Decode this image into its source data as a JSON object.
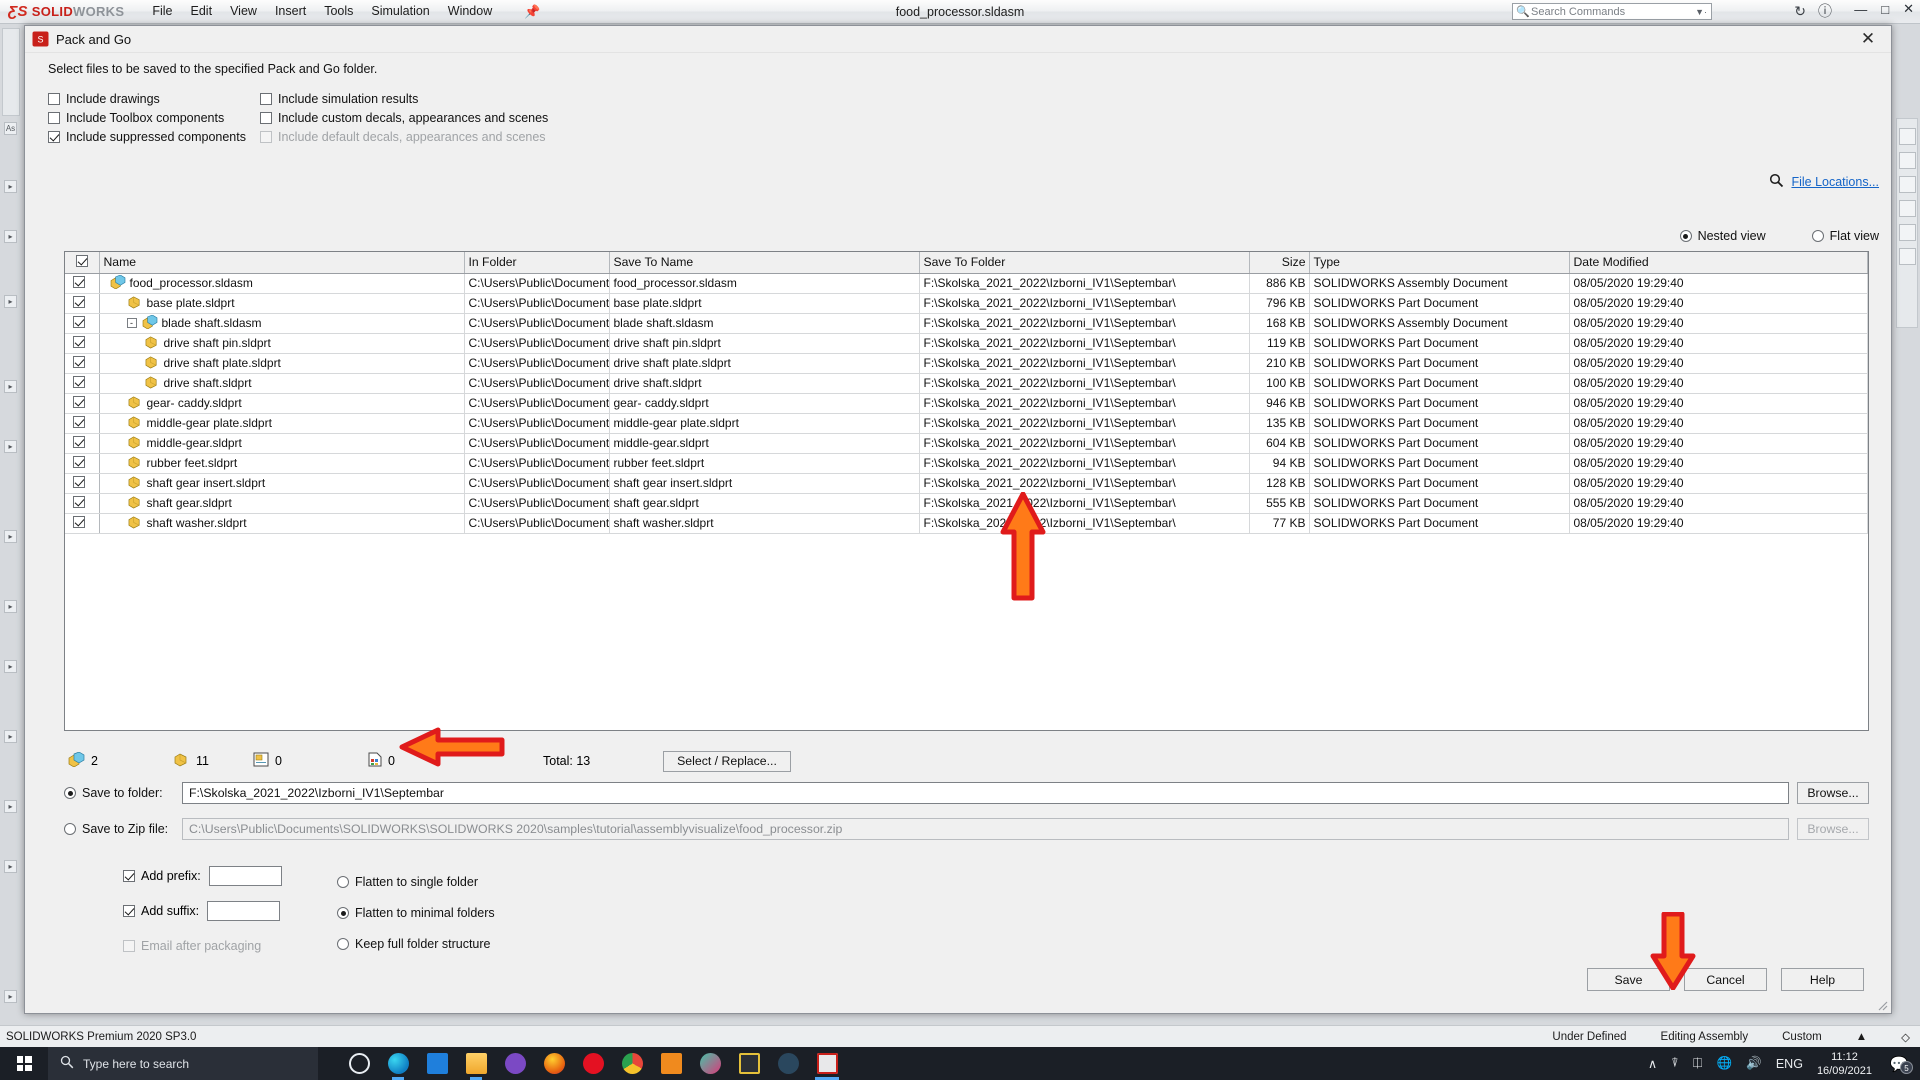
{
  "app": {
    "brand_ds": "3DS",
    "brand_solid": "SOLID",
    "brand_works": "WORKS",
    "menu": [
      "File",
      "Edit",
      "View",
      "Insert",
      "Tools",
      "Simulation",
      "Window"
    ],
    "pin_icon": "pin-icon",
    "document_title": "food_processor.sldasm",
    "search_placeholder": "Search Commands",
    "search_icon": "search-icon",
    "status_left": "SOLIDWORKS Premium 2020 SP3.0",
    "status_right": [
      "Under Defined",
      "Editing Assembly",
      "Custom"
    ],
    "accent_red": "#c8201a"
  },
  "taskbar": {
    "start_icon": "windows-start-icon",
    "search_placeholder": "Type here to search",
    "search_icon": "search-icon",
    "icons": [
      "cortana-icon",
      "microsoft-edge-icon",
      "mail-icon",
      "file-explorer-icon",
      "viber-icon",
      "firefox-icon",
      "opera-icon",
      "google-chrome-icon",
      "movies-tv-icon",
      "dropbox-icon",
      "sublime-text-icon",
      "steam-icon",
      "solidworks-icon"
    ],
    "tray_icons": [
      "chevron-up-icon",
      "screen-record-icon",
      "bluetooth-icon",
      "network-icon",
      "volume-icon"
    ],
    "language": "ENG",
    "time": "11:12",
    "date": "16/09/2021",
    "notification_icon": "notification-icon",
    "notification_count": "5"
  },
  "dialog": {
    "title": "Pack and Go",
    "title_icon": "solidworks-cube-icon",
    "close_icon": "close-icon",
    "instruction": "Select files to be saved to the specified Pack and Go folder.",
    "include_options_col1": [
      {
        "label": "Include drawings",
        "checked": false,
        "disabled": false
      },
      {
        "label": "Include Toolbox components",
        "checked": false,
        "disabled": false
      },
      {
        "label": "Include suppressed components",
        "checked": true,
        "disabled": false
      }
    ],
    "include_options_col2": [
      {
        "label": "Include simulation results",
        "checked": false,
        "disabled": false
      },
      {
        "label": "Include custom decals, appearances and scenes",
        "checked": false,
        "disabled": false
      },
      {
        "label": "Include default decals, appearances and scenes",
        "checked": false,
        "disabled": true
      }
    ],
    "file_locations_link": "File Locations...",
    "file_locations_icon": "search-icon",
    "view_modes": [
      {
        "label": "Nested view",
        "selected": true
      },
      {
        "label": "Flat view",
        "selected": false
      }
    ],
    "table": {
      "select_all_checked": true,
      "columns": [
        "Name",
        "In Folder",
        "Save To Name",
        "Save To Folder",
        "Size",
        "Type",
        "Date Modified"
      ],
      "rows": [
        {
          "checked": true,
          "indent": 0,
          "expander": "",
          "icon": "assembly-icon",
          "name": "food_processor.sldasm",
          "in_folder": "C:\\Users\\Public\\Documents",
          "save_to_name": "food_processor.sldasm",
          "save_to_folder": "F:\\Skolska_2021_2022\\Izborni_IV1\\Septembar\\",
          "size": "886 KB",
          "type": "SOLIDWORKS Assembly Document",
          "date_modified": "08/05/2020 19:29:40"
        },
        {
          "checked": true,
          "indent": 1,
          "expander": "",
          "icon": "part-icon",
          "name": "base plate.sldprt",
          "in_folder": "C:\\Users\\Public\\Documents",
          "save_to_name": "base plate.sldprt",
          "save_to_folder": "F:\\Skolska_2021_2022\\Izborni_IV1\\Septembar\\",
          "size": "796 KB",
          "type": "SOLIDWORKS Part Document",
          "date_modified": "08/05/2020 19:29:40"
        },
        {
          "checked": true,
          "indent": 1,
          "expander": "-",
          "icon": "assembly-icon",
          "name": "blade shaft.sldasm",
          "in_folder": "C:\\Users\\Public\\Documents",
          "save_to_name": "blade shaft.sldasm",
          "save_to_folder": "F:\\Skolska_2021_2022\\Izborni_IV1\\Septembar\\",
          "size": "168 KB",
          "type": "SOLIDWORKS Assembly Document",
          "date_modified": "08/05/2020 19:29:40"
        },
        {
          "checked": true,
          "indent": 2,
          "expander": "",
          "icon": "part-icon",
          "name": "drive shaft pin.sldprt",
          "in_folder": "C:\\Users\\Public\\Documents",
          "save_to_name": "drive shaft pin.sldprt",
          "save_to_folder": "F:\\Skolska_2021_2022\\Izborni_IV1\\Septembar\\",
          "size": "119 KB",
          "type": "SOLIDWORKS Part Document",
          "date_modified": "08/05/2020 19:29:40"
        },
        {
          "checked": true,
          "indent": 2,
          "expander": "",
          "icon": "part-icon",
          "name": "drive shaft plate.sldprt",
          "in_folder": "C:\\Users\\Public\\Documents",
          "save_to_name": "drive shaft plate.sldprt",
          "save_to_folder": "F:\\Skolska_2021_2022\\Izborni_IV1\\Septembar\\",
          "size": "210 KB",
          "type": "SOLIDWORKS Part Document",
          "date_modified": "08/05/2020 19:29:40"
        },
        {
          "checked": true,
          "indent": 2,
          "expander": "",
          "icon": "part-icon",
          "name": "drive shaft.sldprt",
          "in_folder": "C:\\Users\\Public\\Documents",
          "save_to_name": "drive shaft.sldprt",
          "save_to_folder": "F:\\Skolska_2021_2022\\Izborni_IV1\\Septembar\\",
          "size": "100 KB",
          "type": "SOLIDWORKS Part Document",
          "date_modified": "08/05/2020 19:29:40"
        },
        {
          "checked": true,
          "indent": 1,
          "expander": "",
          "icon": "part-icon",
          "name": "gear- caddy.sldprt",
          "in_folder": "C:\\Users\\Public\\Documents",
          "save_to_name": "gear- caddy.sldprt",
          "save_to_folder": "F:\\Skolska_2021_2022\\Izborni_IV1\\Septembar\\",
          "size": "946 KB",
          "type": "SOLIDWORKS Part Document",
          "date_modified": "08/05/2020 19:29:40"
        },
        {
          "checked": true,
          "indent": 1,
          "expander": "",
          "icon": "part-icon",
          "name": "middle-gear plate.sldprt",
          "in_folder": "C:\\Users\\Public\\Documents",
          "save_to_name": "middle-gear plate.sldprt",
          "save_to_folder": "F:\\Skolska_2021_2022\\Izborni_IV1\\Septembar\\",
          "size": "135 KB",
          "type": "SOLIDWORKS Part Document",
          "date_modified": "08/05/2020 19:29:40"
        },
        {
          "checked": true,
          "indent": 1,
          "expander": "",
          "icon": "part-icon",
          "name": "middle-gear.sldprt",
          "in_folder": "C:\\Users\\Public\\Documents",
          "save_to_name": "middle-gear.sldprt",
          "save_to_folder": "F:\\Skolska_2021_2022\\Izborni_IV1\\Septembar\\",
          "size": "604 KB",
          "type": "SOLIDWORKS Part Document",
          "date_modified": "08/05/2020 19:29:40"
        },
        {
          "checked": true,
          "indent": 1,
          "expander": "",
          "icon": "part-icon",
          "name": "rubber feet.sldprt",
          "in_folder": "C:\\Users\\Public\\Documents",
          "save_to_name": "rubber feet.sldprt",
          "save_to_folder": "F:\\Skolska_2021_2022\\Izborni_IV1\\Septembar\\",
          "size": "94 KB",
          "type": "SOLIDWORKS Part Document",
          "date_modified": "08/05/2020 19:29:40"
        },
        {
          "checked": true,
          "indent": 1,
          "expander": "",
          "icon": "part-icon",
          "name": "shaft gear insert.sldprt",
          "in_folder": "C:\\Users\\Public\\Documents",
          "save_to_name": "shaft gear insert.sldprt",
          "save_to_folder": "F:\\Skolska_2021_2022\\Izborni_IV1\\Septembar\\",
          "size": "128 KB",
          "type": "SOLIDWORKS Part Document",
          "date_modified": "08/05/2020 19:29:40"
        },
        {
          "checked": true,
          "indent": 1,
          "expander": "",
          "icon": "part-icon",
          "name": "shaft gear.sldprt",
          "in_folder": "C:\\Users\\Public\\Documents",
          "save_to_name": "shaft gear.sldprt",
          "save_to_folder": "F:\\Skolska_2021_2022\\Izborni_IV1\\Septembar\\",
          "size": "555 KB",
          "type": "SOLIDWORKS Part Document",
          "date_modified": "08/05/2020 19:29:40"
        },
        {
          "checked": true,
          "indent": 1,
          "expander": "",
          "icon": "part-icon",
          "name": "shaft washer.sldprt",
          "in_folder": "C:\\Users\\Public\\Documents",
          "save_to_name": "shaft washer.sldprt",
          "save_to_folder": "F:\\Skolska_2021_2022\\Izborni_IV1\\Septembar\\",
          "size": "77 KB",
          "type": "SOLIDWORKS Part Document",
          "date_modified": "08/05/2020 19:29:40"
        }
      ]
    },
    "summary": {
      "assemblies_icon": "assembly-icon",
      "assemblies_count": "2",
      "parts_icon": "part-icon",
      "parts_count": "11",
      "drawings_icon": "drawing-icon",
      "drawings_count": "0",
      "other_icon": "other-file-icon",
      "other_count": "0",
      "total_label": "Total: 13",
      "select_replace_label": "Select / Replace..."
    },
    "save_to_folder": {
      "label": "Save to folder:",
      "selected": true,
      "value": "F:\\Skolska_2021_2022\\Izborni_IV1\\Septembar",
      "browse_label": "Browse..."
    },
    "save_to_zip": {
      "label": "Save to Zip file:",
      "selected": false,
      "value": "C:\\Users\\Public\\Documents\\SOLIDWORKS\\SOLIDWORKS 2020\\samples\\tutorial\\assemblyvisualize\\food_processor.zip",
      "browse_label": "Browse..."
    },
    "bottom_options": [
      {
        "label": "Add prefix:",
        "checked": true,
        "disabled": false,
        "has_input": true,
        "input_value": ""
      },
      {
        "label": "Add suffix:",
        "checked": true,
        "disabled": false,
        "has_input": true,
        "input_value": ""
      },
      {
        "label": "Email after packaging",
        "checked": false,
        "disabled": true,
        "has_input": false,
        "input_value": ""
      }
    ],
    "flatten_options": [
      {
        "label": "Flatten to single folder",
        "selected": false
      },
      {
        "label": "Flatten to minimal folders",
        "selected": true
      },
      {
        "label": "Keep full folder structure",
        "selected": false
      }
    ],
    "buttons": [
      {
        "label": "Save",
        "name": "save-button"
      },
      {
        "label": "Cancel",
        "name": "cancel-button"
      },
      {
        "label": "Help",
        "name": "help-button"
      }
    ]
  },
  "annotations": {
    "arrow_color": "#ff7a18",
    "arrow_outline": "#e01b1b",
    "arrow_table_name": "arrow-pointing-to-file-table",
    "arrow_folder_name": "arrow-pointing-to-save-folder-field",
    "arrow_save_name": "arrow-pointing-to-save-button"
  }
}
